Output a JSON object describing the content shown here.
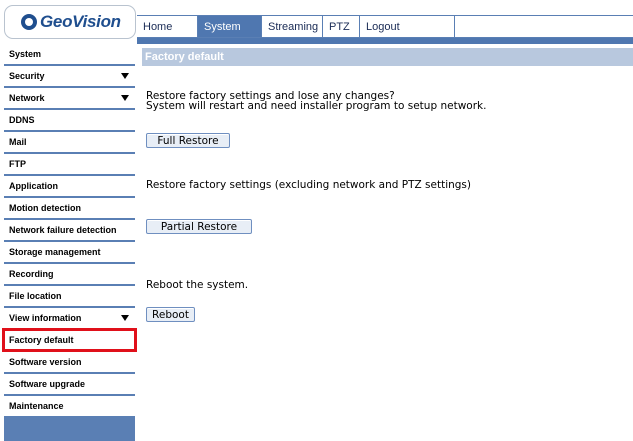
{
  "brand": {
    "logo_text": "GeoVision"
  },
  "topnav": {
    "tabs": [
      {
        "label": "Home",
        "active": false
      },
      {
        "label": "System",
        "active": true
      },
      {
        "label": "Streaming",
        "active": false
      },
      {
        "label": "PTZ",
        "active": false
      },
      {
        "label": "Logout",
        "active": false
      }
    ]
  },
  "sidebar": {
    "items": [
      {
        "label": "System",
        "expandable": false
      },
      {
        "label": "Security",
        "expandable": true
      },
      {
        "label": "Network",
        "expandable": true
      },
      {
        "label": "DDNS",
        "expandable": false
      },
      {
        "label": "Mail",
        "expandable": false
      },
      {
        "label": "FTP",
        "expandable": false
      },
      {
        "label": "Application",
        "expandable": false
      },
      {
        "label": "Motion detection",
        "expandable": false
      },
      {
        "label": "Network failure detection",
        "expandable": false
      },
      {
        "label": "Storage management",
        "expandable": false
      },
      {
        "label": "Recording",
        "expandable": false
      },
      {
        "label": "File location",
        "expandable": false
      },
      {
        "label": "View information",
        "expandable": true
      },
      {
        "label": "Factory default",
        "expandable": false,
        "selected": true
      },
      {
        "label": "Software version",
        "expandable": false
      },
      {
        "label": "Software upgrade",
        "expandable": false
      },
      {
        "label": "Maintenance",
        "expandable": false
      }
    ]
  },
  "main": {
    "section_title": "Factory default",
    "full_restore": {
      "line1": "Restore factory settings and lose any changes?",
      "line2": "System will restart and need installer program to setup network.",
      "button_label": "Full Restore"
    },
    "partial_restore": {
      "text": "Restore factory settings (excluding network and PTZ settings)",
      "button_label": "Partial Restore"
    },
    "reboot": {
      "text": "Reboot the system.",
      "button_label": "Reboot"
    }
  },
  "colors": {
    "nav_blue": "#4f77b0",
    "sidebar_blue": "#5a7fb4",
    "header_bg": "#b8c8de",
    "selected_outline": "#e0101a"
  }
}
